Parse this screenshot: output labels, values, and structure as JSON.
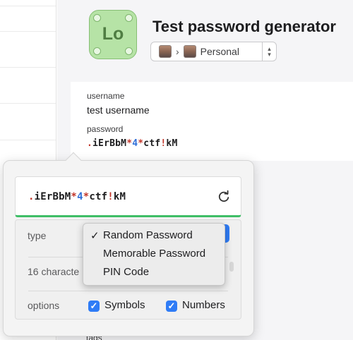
{
  "item": {
    "title": "Test password generator",
    "icon_text": "Lo",
    "icon_name": "login-item-icon",
    "vault": {
      "label": "Personal",
      "chevron": "›",
      "stepper_up": "▴",
      "stepper_down": "▾"
    }
  },
  "fields": {
    "username_label": "username",
    "username_value": "test username",
    "password_label": "password",
    "password_segments": [
      {
        "text": ".",
        "kind": "dot"
      },
      {
        "text": "iErBbM",
        "kind": "char"
      },
      {
        "text": "*",
        "kind": "sym"
      },
      {
        "text": "4",
        "kind": "num"
      },
      {
        "text": "*",
        "kind": "sym"
      },
      {
        "text": "ctf",
        "kind": "char"
      },
      {
        "text": "!",
        "kind": "sym"
      },
      {
        "text": "kM",
        "kind": "char"
      }
    ],
    "tags_label": "tags"
  },
  "generator": {
    "type_label": "type",
    "length_label": "16 characte",
    "options_label": "options",
    "symbols_label": "Symbols",
    "symbols_checked": true,
    "numbers_label": "Numbers",
    "numbers_checked": true,
    "checkmark": "✓"
  },
  "type_menu": {
    "selected_index": 0,
    "items": [
      "Random Password",
      "Memorable Password",
      "PIN Code"
    ]
  },
  "colors": {
    "accent": "#2f7cf6",
    "strength_bar": "#3fbe67",
    "symbol": "#c2362a",
    "number": "#2f6fd8",
    "icon_bg": "#b6e3a6"
  }
}
